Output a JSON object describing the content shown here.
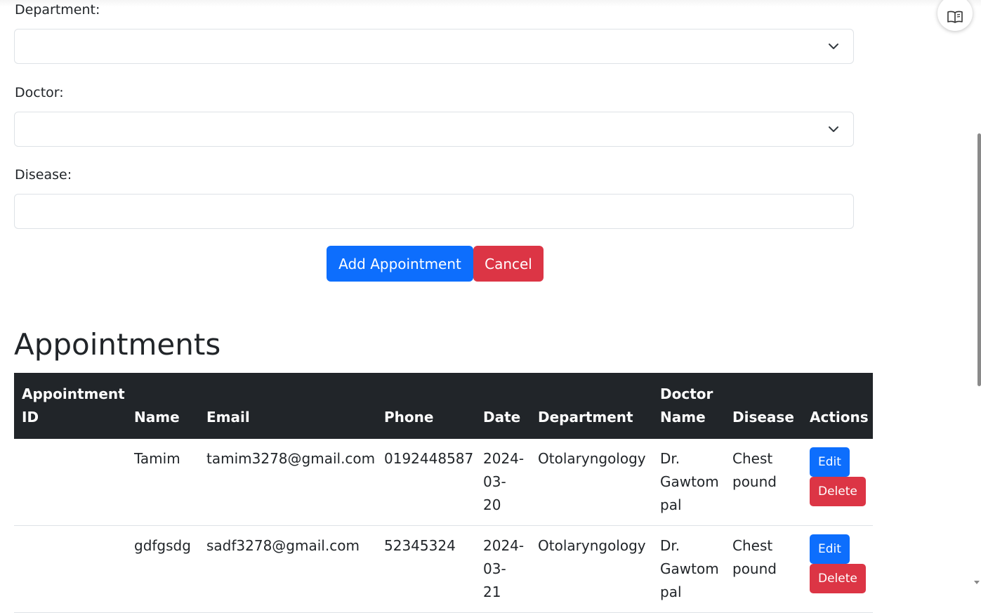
{
  "form": {
    "department_label": "Department:",
    "department_value": "",
    "doctor_label": "Doctor:",
    "doctor_value": "",
    "disease_label": "Disease:",
    "disease_value": "",
    "add_button": "Add Appointment",
    "cancel_button": "Cancel"
  },
  "appointments": {
    "title": "Appointments",
    "columns": {
      "id": "Appointment ID",
      "name": "Name",
      "email": "Email",
      "phone": "Phone",
      "date": "Date",
      "department": "Department",
      "doctor": "Doctor Name",
      "disease": "Disease",
      "actions": "Actions"
    },
    "rows": [
      {
        "id": "",
        "name": "Tamim",
        "email": "tamim3278@gmail.com",
        "phone": "0192448587",
        "date": "2024-03-20",
        "department": "Otolaryngology",
        "doctor": "Dr. Gawtom pal",
        "disease": "Chest pound",
        "edit": "Edit",
        "delete": "Delete"
      },
      {
        "id": "",
        "name": "gdfgsdg",
        "email": "sadf3278@gmail.com",
        "phone": "52345324",
        "date": "2024-03-21",
        "department": "Otolaryngology",
        "doctor": "Dr. Gawtom pal",
        "disease": "Chest pound",
        "edit": "Edit",
        "delete": "Delete"
      }
    ]
  },
  "icons": {
    "reader": "book-open-icon",
    "select_arrow": "chevron-down-icon"
  },
  "colors": {
    "primary": "#0d6efd",
    "danger": "#dc3545",
    "table_header": "#212529"
  }
}
